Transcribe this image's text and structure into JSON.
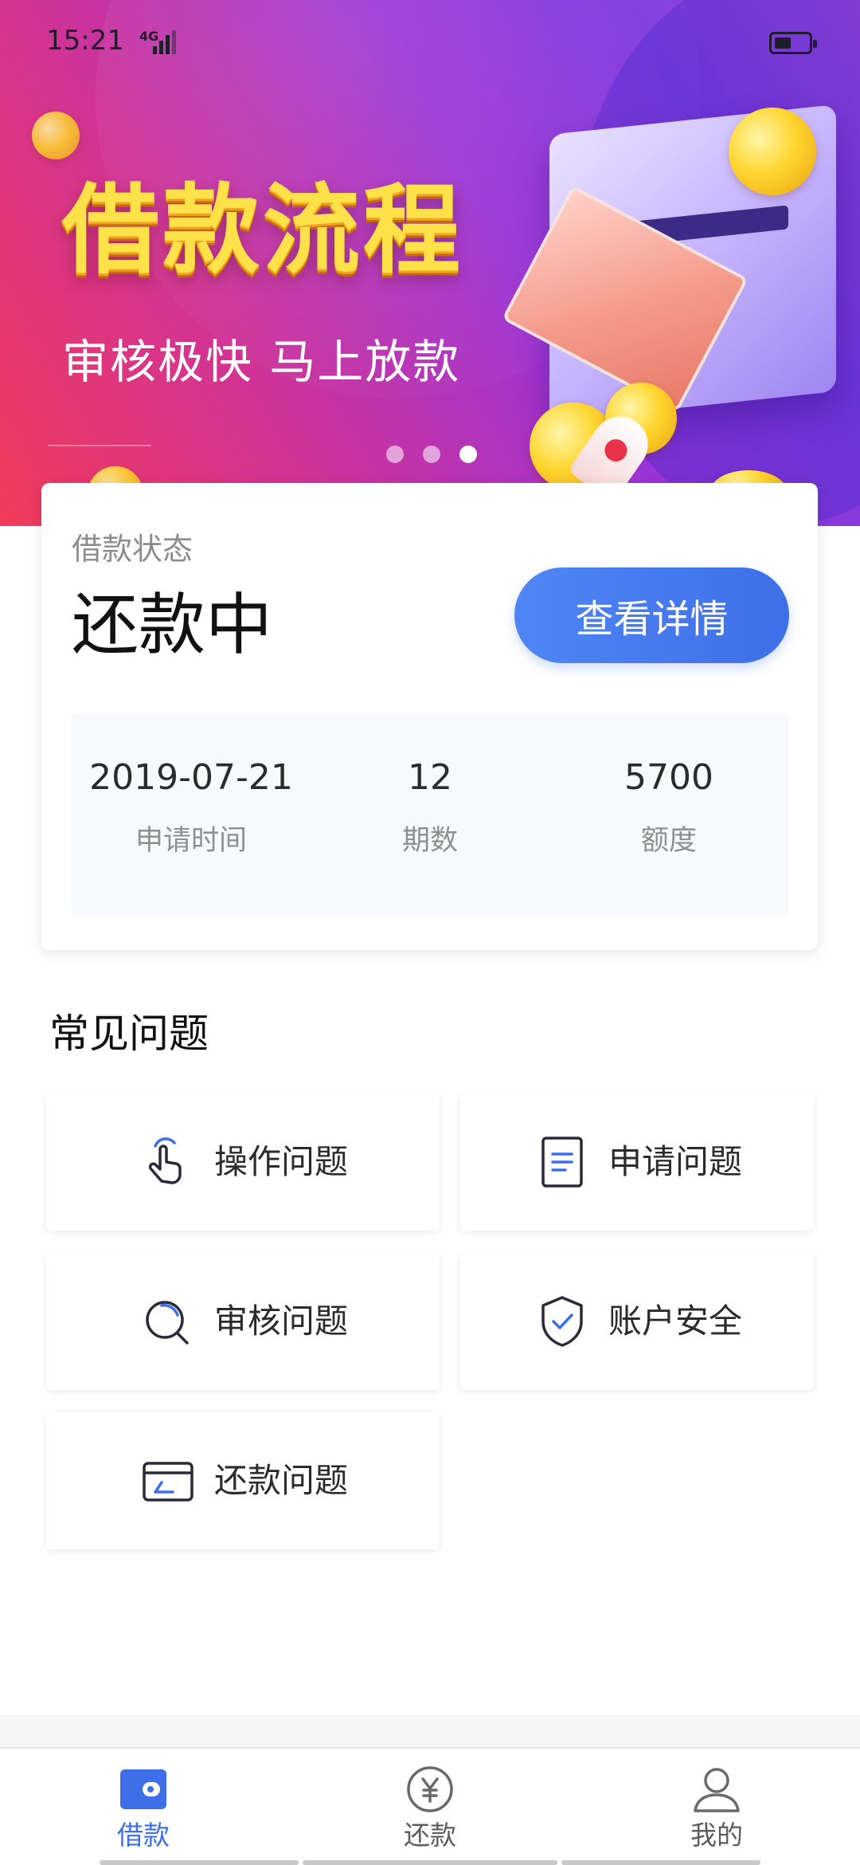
{
  "status_bar": {
    "time": "15:21",
    "network": "4G"
  },
  "banner": {
    "title": "借款流程",
    "subtitle": "审核极快 马上放款",
    "dots": 3,
    "active_dot": 3
  },
  "loan_status": {
    "label": "借款状态",
    "status": "还款中",
    "detail_button": "查看详情",
    "stats": [
      {
        "value": "2019-07-21",
        "label": "申请时间"
      },
      {
        "value": "12",
        "label": "期数"
      },
      {
        "value": "5700",
        "label": "额度"
      }
    ]
  },
  "faq": {
    "title": "常见问题",
    "items": [
      {
        "label": "操作问题",
        "icon": "tap-hand-icon"
      },
      {
        "label": "申请问题",
        "icon": "document-icon"
      },
      {
        "label": "审核问题",
        "icon": "search-icon"
      },
      {
        "label": "账户安全",
        "icon": "shield-check-icon"
      },
      {
        "label": "还款问题",
        "icon": "card-icon"
      }
    ]
  },
  "bottom_nav": {
    "items": [
      {
        "label": "借款",
        "icon": "wallet-icon",
        "active": true
      },
      {
        "label": "还款",
        "icon": "yen-circle-icon",
        "active": false
      },
      {
        "label": "我的",
        "icon": "user-icon",
        "active": false
      }
    ]
  },
  "colors": {
    "accent": "#3e6fe8",
    "banner_title": "#ffe14a",
    "text_primary": "#111111",
    "text_secondary": "#8c8c8c"
  }
}
